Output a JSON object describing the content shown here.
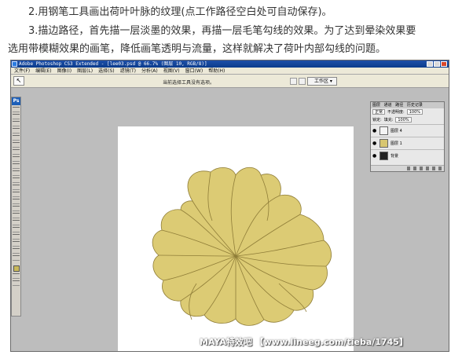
{
  "article": {
    "line1": "2.用钢笔工具画出荷叶叶脉的纹理(点工作路径空白处可自动保存)。",
    "line2": "3.描边路径，首先描一层淡墨的效果，再描一层毛笔勾线的效果。为了达到晕染效果要",
    "line3": "选用带模糊效果的画笔，降低画笔透明与流量，这样就解决了荷叶内部勾线的问题。"
  },
  "window": {
    "title": "Adobe Photoshop CS3 Extended - [lee03.psd @ 66.7% (图层 10, RGB/8)]",
    "menus": [
      "文件(F)",
      "编辑(E)",
      "图像(I)",
      "图层(L)",
      "选择(S)",
      "滤镜(T)",
      "分析(A)",
      "视图(V)",
      "窗口(W)",
      "帮助(H)"
    ]
  },
  "options_bar": {
    "hint": "当前选择工具没有选项。",
    "workspace": "工作区 ▾"
  },
  "toolbox": {
    "logo": "Ps"
  },
  "layers_panel": {
    "tabs": [
      "图层",
      "通道",
      "路径",
      "历史记录"
    ],
    "blend_mode": "正常",
    "opacity_label": "不透明度:",
    "opacity_value": "100%",
    "lock_label": "锁定:",
    "fill_label": "填充:",
    "fill_value": "100%",
    "layers": [
      {
        "name": "图层 4",
        "thumb": "plain"
      },
      {
        "name": "图层 1",
        "thumb": "yellow"
      },
      {
        "name": "背景",
        "thumb": "dark"
      }
    ]
  },
  "colors": {
    "leaf_fill": "#dccb74",
    "leaf_stroke": "#8f7d38",
    "canvas_bg": "#bdbdbd",
    "foreground_swatch": "#c9b85a"
  },
  "watermark": "MAYA特效吧 【www.lineeg.com/tieba/1745】"
}
